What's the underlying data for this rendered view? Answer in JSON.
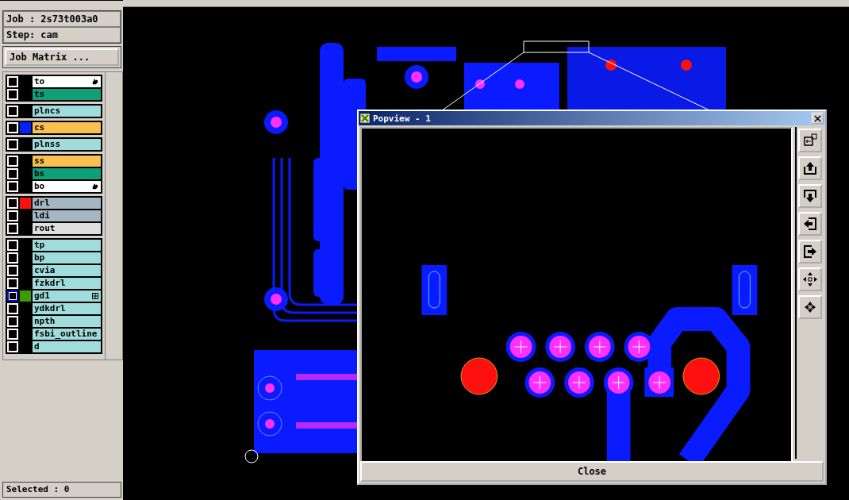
{
  "job_panel": {
    "job": "Job : 2s73t003a0",
    "step": "Step: cam",
    "matrix_button": "Job Matrix ..."
  },
  "layer_groups": [
    {
      "layers": [
        {
          "name": "to",
          "kind": "silk",
          "checked": false,
          "highlighted": false,
          "pointed": true
        },
        {
          "name": "ts",
          "kind": "mask",
          "checked": false,
          "highlighted": false
        }
      ]
    },
    {
      "layers": [
        {
          "name": "plncs",
          "kind": "paste",
          "checked": false,
          "highlighted": false
        }
      ]
    },
    {
      "layers": [
        {
          "name": "cs",
          "kind": "signal",
          "checked": false,
          "highlighted": false,
          "color": "#0022ff"
        }
      ]
    },
    {
      "layers": [
        {
          "name": "plnss",
          "kind": "paste",
          "checked": false,
          "highlighted": false
        }
      ]
    },
    {
      "layers": [
        {
          "name": "ss",
          "kind": "signal",
          "checked": false,
          "highlighted": false
        },
        {
          "name": "bs",
          "kind": "mask",
          "checked": false,
          "highlighted": false
        },
        {
          "name": "bo",
          "kind": "silk",
          "checked": false,
          "highlighted": false,
          "pointed": true
        }
      ]
    },
    {
      "layers": [
        {
          "name": "drl",
          "kind": "drill",
          "checked": false,
          "highlighted": false,
          "color": "#ff1010"
        },
        {
          "name": "ldi",
          "kind": "drill",
          "checked": false,
          "highlighted": false
        },
        {
          "name": "rout",
          "kind": "rout",
          "checked": false,
          "highlighted": false
        }
      ]
    },
    {
      "layers": [
        {
          "name": "tp",
          "kind": "document",
          "checked": false,
          "highlighted": false
        },
        {
          "name": "bp",
          "kind": "document",
          "checked": false,
          "highlighted": false
        },
        {
          "name": "cvia",
          "kind": "document",
          "checked": false,
          "highlighted": false
        },
        {
          "name": "fzkdrl",
          "kind": "document",
          "checked": false,
          "highlighted": false
        },
        {
          "name": "gd1",
          "kind": "document",
          "checked": false,
          "highlighted": true,
          "color": "#3c9a00",
          "expandable": true
        },
        {
          "name": "ydkdrl",
          "kind": "document",
          "checked": false,
          "highlighted": false
        },
        {
          "name": "npth",
          "kind": "document",
          "checked": false,
          "highlighted": false
        },
        {
          "name": "fsbi_outline",
          "kind": "document",
          "checked": false,
          "highlighted": false
        },
        {
          "name": "d",
          "kind": "document",
          "checked": false,
          "highlighted": false
        }
      ]
    }
  ],
  "status": "Selected : 0",
  "popview": {
    "title": "Popview - 1",
    "close_button": "Close",
    "tools": [
      {
        "kind": "fit"
      },
      {
        "kind": "up"
      },
      {
        "kind": "down"
      },
      {
        "kind": "left"
      },
      {
        "kind": "right"
      },
      {
        "kind": "zoom-in"
      },
      {
        "kind": "zoom-out"
      }
    ]
  }
}
